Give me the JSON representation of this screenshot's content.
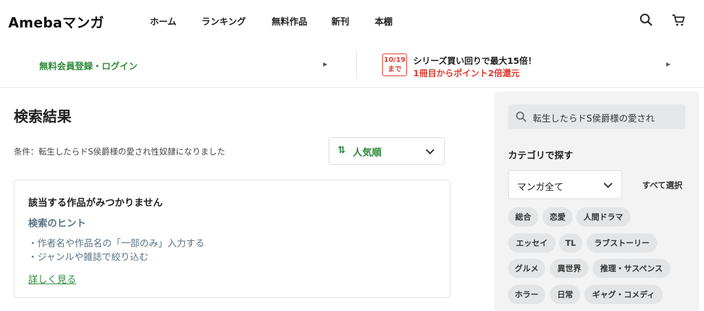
{
  "header": {
    "logo": "Amebaマンガ",
    "nav": [
      "ホーム",
      "ランキング",
      "無料作品",
      "新刊",
      "本棚"
    ]
  },
  "banner": {
    "login": "無料会員登録・ログイン",
    "badge_date": "10/19",
    "badge_until": "まで",
    "campaign_line1": "シリーズ買い回りで最大15倍！",
    "campaign_line2": "1冊目からポイント2倍還元"
  },
  "main": {
    "title": "検索結果",
    "condition": "条件：転生したらドS侯爵様の愛され性奴隷になりました",
    "sort_label": "人気順",
    "not_found": "該当する作品がみつかりません",
    "hint_title": "検索のヒント",
    "hints": [
      "・作者名や作品名の「一部のみ」入力する",
      "・ジャンルや雑誌で絞り込む"
    ],
    "more_link": "詳しく見る"
  },
  "sidebar": {
    "search_value": "転生したらドS侯爵様の愛され",
    "category_title": "カテゴリで探す",
    "category_select": "マンガ全て",
    "select_all": "すべて選択",
    "tags": [
      "総合",
      "恋愛",
      "人間ドラマ",
      "エッセイ",
      "TL",
      "ラブストーリー",
      "グルメ",
      "異世界",
      "推理・サスペンス",
      "ホラー",
      "日常",
      "ギャグ・コメディ"
    ]
  },
  "colors": {
    "accent_green": "#2e8b3a",
    "campaign_red": "#e03a2f",
    "hint_gray_blue": "#5a7384"
  }
}
